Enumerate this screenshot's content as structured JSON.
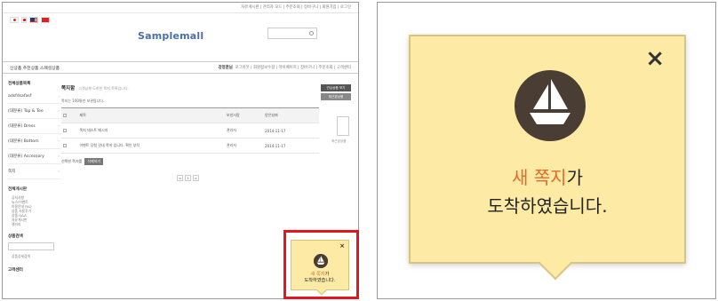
{
  "site": {
    "logo": "Samplemall",
    "top_links": "자유게시판  |  관리자 모드  |  주문조회  |  장바구니  |  회원가입  |  로그인",
    "nav_left": "신상품   추천상품   스페셜상품",
    "nav_user": "강정훈님",
    "nav_right": "로그아웃  |  회원정보수정  |  마이페이지  |  장바구니  |  주문조회  |  고객센터",
    "sidebar_title": "전체상품목록",
    "sidebar_items": [
      "adsfdsafasf",
      "(대분류) Top & Tee",
      "(대분류) Dress",
      "(대분류) Bottom",
      "(대분류) Accessory",
      "쪽지"
    ],
    "sidebar_section_2": "전체게시판",
    "sidebar_small": [
      "공지사항",
      "뉴스/이벤트",
      "이용안내 FAQ",
      "상품 사용후기",
      "상품 Q&A",
      "자유게시판",
      "갤러리"
    ],
    "sidebar_section_3": "상품검색",
    "sidebar_link": "상품상세검색",
    "sidebar_section_4": "고객센터"
  },
  "page": {
    "title": "쪽지함",
    "subtitle": "고객님께 도착한 쪽지 목록입니다.",
    "count_text": "쪽지는 100통만 보관됩니다.",
    "headers": [
      "",
      "제목",
      "보낸사람",
      "받은날짜"
    ],
    "rows": [
      {
        "subject": "쪽지 테스트 메시지",
        "sender": "관리자",
        "date": "2014-11-17"
      },
      {
        "subject": "이벤트 당첨 안내 쪽지 입니다. 확인 부탁",
        "sender": "관리자",
        "date": "2014-11-17"
      }
    ],
    "bulk_label": "선택한 쪽지를",
    "bulk_button": "삭제하기",
    "pager": [
      "<",
      "1",
      ">"
    ],
    "right_buttons": [
      "관심상품 보기",
      "최근본상품"
    ],
    "right_text": "최근본상품"
  },
  "notice": {
    "close_label": "×",
    "accent_text": "새 쪽지",
    "suffix_text": "가",
    "line2": "도착하였습니다."
  },
  "colors": {
    "popup_bg": "#fdeaa4",
    "accent": "#e86a2a",
    "highlight": "#e4161b",
    "icon_dark": "#4a3d33"
  },
  "icons": [
    "message-boat-icon",
    "close-icon",
    "search-icon"
  ]
}
